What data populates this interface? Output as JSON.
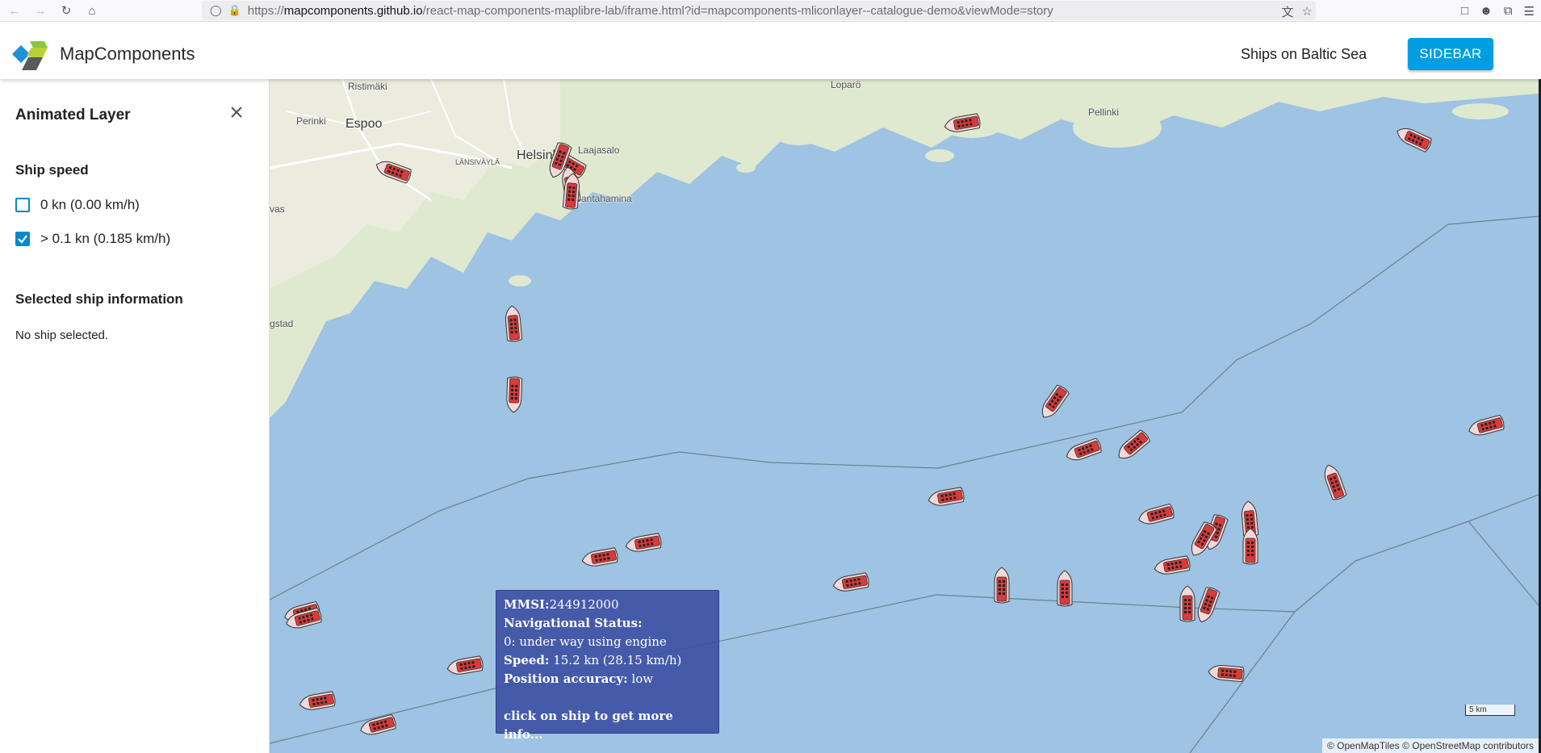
{
  "browser": {
    "url_host": "mapcomponents.github.io",
    "url_path": "/react-map-components-maplibre-lab/iframe.html?id=mapcomponents-mliconlayer--catalogue-demo&viewMode=story"
  },
  "header": {
    "brand": "MapComponents",
    "story_title": "Ships on Baltic Sea",
    "sidebar_button": "SIDEBAR"
  },
  "sidebar": {
    "title": "Animated Layer",
    "speed_heading": "Ship speed",
    "filters": [
      {
        "label": "0 kn (0.00 km/h)",
        "checked": false
      },
      {
        "label": "> 0.1 kn (0.185 km/h)",
        "checked": true
      }
    ],
    "info_heading": "Selected ship information",
    "info_text": "No ship selected."
  },
  "map": {
    "places": [
      "Ristimäki",
      "Perinki",
      "Espoo",
      "Helsinki",
      "Laajasalo",
      "Santahamina",
      "LÄNSIVÄYLÄ",
      "Loparö",
      "Pellinki",
      "vas",
      "gstad"
    ],
    "popup": {
      "mmsi_label": "MMSI:",
      "mmsi": "244912000",
      "nav_label": "Navigational Status:",
      "nav_value": "0: under way using engine",
      "speed_label": "Speed:",
      "speed_value": "15.2 kn (28.15 km/h)",
      "accuracy_label": "Position accuracy:",
      "accuracy_value": "low",
      "hint": "click on ship to get more info..."
    },
    "scale": "5 km",
    "attribution": "© OpenMapTiles © OpenStreetMap contributors",
    "colors": {
      "water": "#9ec3e3",
      "land": "#dfe9cf",
      "ship_hull": "#d93b3b",
      "popup": "#394ca0",
      "button": "#009ee0"
    }
  }
}
